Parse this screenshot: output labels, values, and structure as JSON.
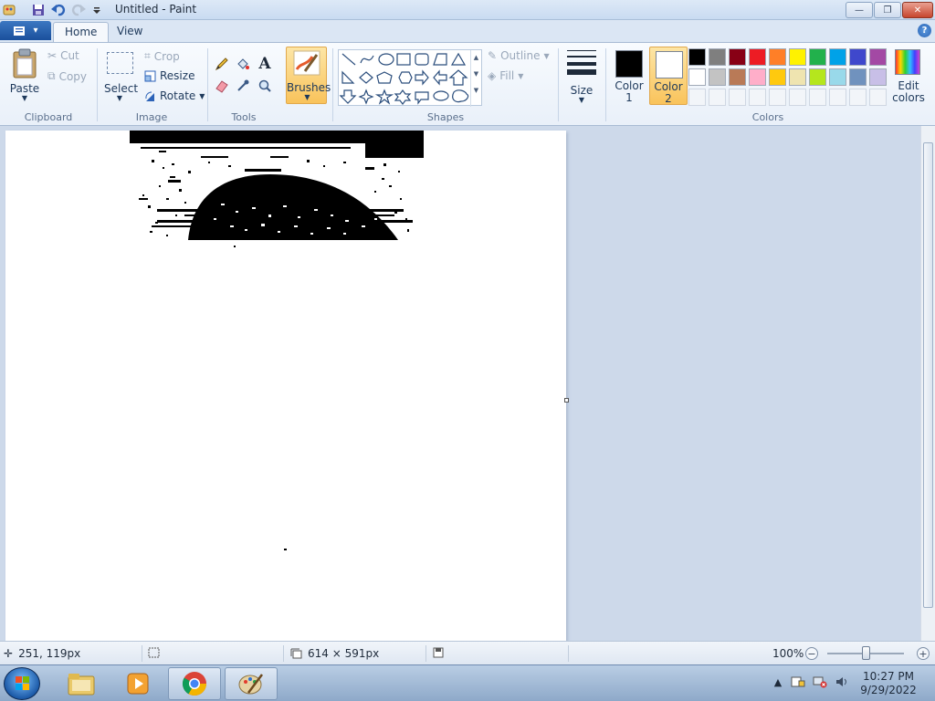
{
  "window": {
    "title": "Untitled - Paint",
    "minimize_glyph": "—",
    "maximize_glyph": "❐",
    "close_glyph": "✕"
  },
  "tabs": {
    "file_glyph": "▾",
    "home": "Home",
    "view": "View",
    "help_glyph": "?"
  },
  "clipboard": {
    "paste": "Paste",
    "cut": "Cut",
    "copy": "Copy",
    "group_label": "Clipboard"
  },
  "image": {
    "select": "Select",
    "crop": "Crop",
    "resize": "Resize",
    "rotate": "Rotate",
    "group_label": "Image"
  },
  "tools": {
    "text_glyph": "A",
    "group_label": "Tools"
  },
  "brushes": {
    "label": "Brushes"
  },
  "shapes": {
    "outline": "Outline",
    "fill": "Fill",
    "group_label": "Shapes"
  },
  "size": {
    "label": "Size"
  },
  "colors": {
    "color1_line1": "Color",
    "color1_line2": "1",
    "color2_line1": "Color",
    "color2_line2": "2",
    "edit_line1": "Edit",
    "edit_line2": "colors",
    "group_label": "Colors",
    "color1_value": "#000000",
    "color2_value": "#ffffff",
    "palette_row1": [
      "#000000",
      "#7f7f7f",
      "#880015",
      "#ed1c24",
      "#ff7f27",
      "#fff200",
      "#22b14c",
      "#00a2e8",
      "#3f48cc",
      "#a349a4"
    ],
    "palette_row2": [
      "#ffffff",
      "#c3c3c3",
      "#b97a57",
      "#ffaec9",
      "#ffc90e",
      "#efe4b0",
      "#b5e61d",
      "#99d9ea",
      "#7092be",
      "#c8bfe7"
    ]
  },
  "status": {
    "cursor_position": "251, 119px",
    "canvas_size": "614 × 591px",
    "zoom": "100%",
    "zoom_level": 1.0
  },
  "taskbar": {
    "time": "10:27 PM",
    "date": "9/29/2022"
  }
}
